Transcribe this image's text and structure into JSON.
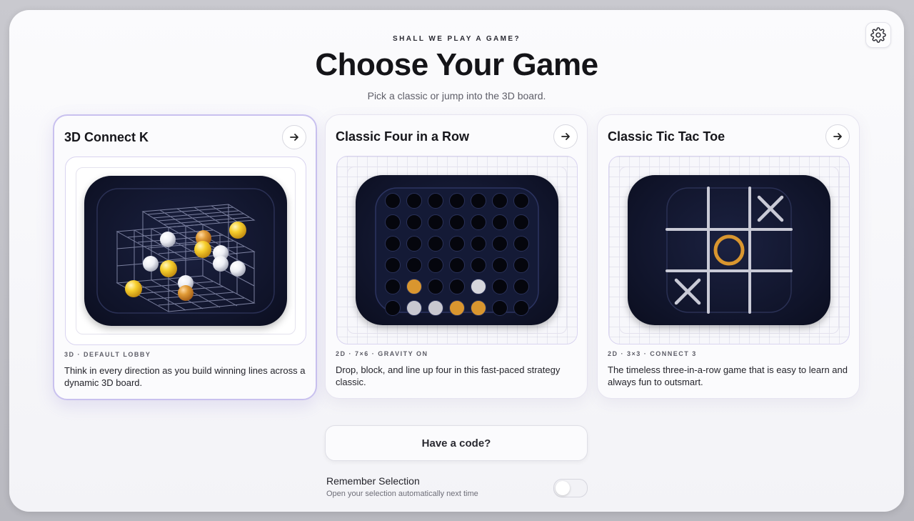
{
  "header": {
    "eyebrow": "SHALL WE PLAY A GAME?",
    "title": "Choose Your Game",
    "subtitle": "Pick a classic or jump into the 3D board."
  },
  "settings": {
    "icon": "gear-icon"
  },
  "cards": [
    {
      "title": "3D Connect K",
      "meta": "3D · DEFAULT LOBBY",
      "description": "Think in every direction as you build winning lines across a dynamic 3D board.",
      "selected": true,
      "icon": "arrow-right-icon"
    },
    {
      "title": "Classic Four in a Row",
      "meta": "2D · 7×6 · GRAVITY ON",
      "description": "Drop, block, and line up four in this fast-paced strategy classic.",
      "selected": false,
      "icon": "arrow-right-icon"
    },
    {
      "title": "Classic Tic Tac Toe",
      "meta": "2D · 3×3 · CONNECT 3",
      "description": "The timeless three-in-a-row game that is easy to learn and always fun to outsmart.",
      "selected": false,
      "icon": "arrow-right-icon"
    }
  ],
  "code_button": {
    "label": "Have a code?"
  },
  "remember": {
    "label": "Remember Selection",
    "sublabel": "Open your selection automatically next time",
    "enabled": false
  },
  "colors": {
    "accent_border": "#c9c1ef",
    "board_dark": "#10142a",
    "piece_orange": "#d9962f",
    "piece_gold": "#f5c531",
    "piece_white": "#e8e8ee"
  }
}
